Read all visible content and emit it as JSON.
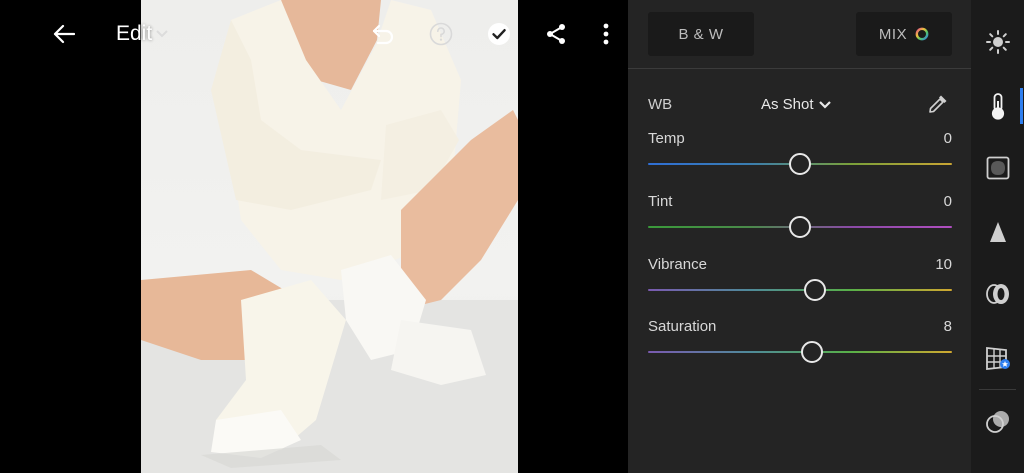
{
  "toolbar": {
    "edit_label": "Edit"
  },
  "panel": {
    "bw_label": "B & W",
    "mix_label": "MIX",
    "wb": {
      "label": "WB",
      "value": "As Shot"
    },
    "sliders": [
      {
        "label": "Temp",
        "value": "0",
        "level": 0.5
      },
      {
        "label": "Tint",
        "value": "0",
        "level": 0.5
      },
      {
        "label": "Vibrance",
        "value": "10",
        "level": 0.55
      },
      {
        "label": "Saturation",
        "value": "8",
        "level": 0.54
      }
    ]
  },
  "colors": {
    "panel_bg": "#242424",
    "rail_bg": "#1b1b1b",
    "active_accent": "#2f7ff0",
    "temp_gradient": [
      "#2f6fd6",
      "#3a7db0",
      "#7aa03a",
      "#c9a534"
    ],
    "tint_gradient": [
      "#3a9a3a",
      "#4a8a4a",
      "#8a4aa6",
      "#b04ec0"
    ],
    "vibrance_gradient": [
      "#7a5ab0",
      "#4f8a9a",
      "#58b048",
      "#d0a830"
    ],
    "saturation_gradient": [
      "#7a5ab0",
      "#4f8a9a",
      "#58b048",
      "#d0a830"
    ]
  },
  "icons": {
    "back": "arrow-left-icon",
    "edit_caret": "chevron-down-icon",
    "undo": "undo-icon",
    "help": "help-icon",
    "done": "check-circle-icon",
    "share": "share-icon",
    "more": "more-vertical-icon",
    "mix": "color-wheel-icon",
    "eyedropper": "eyedropper-icon",
    "rail": [
      "light-icon",
      "color-thermometer-icon",
      "effects-icon",
      "detail-icon",
      "optics-icon",
      "geometry-icon",
      "presets-icon"
    ]
  }
}
